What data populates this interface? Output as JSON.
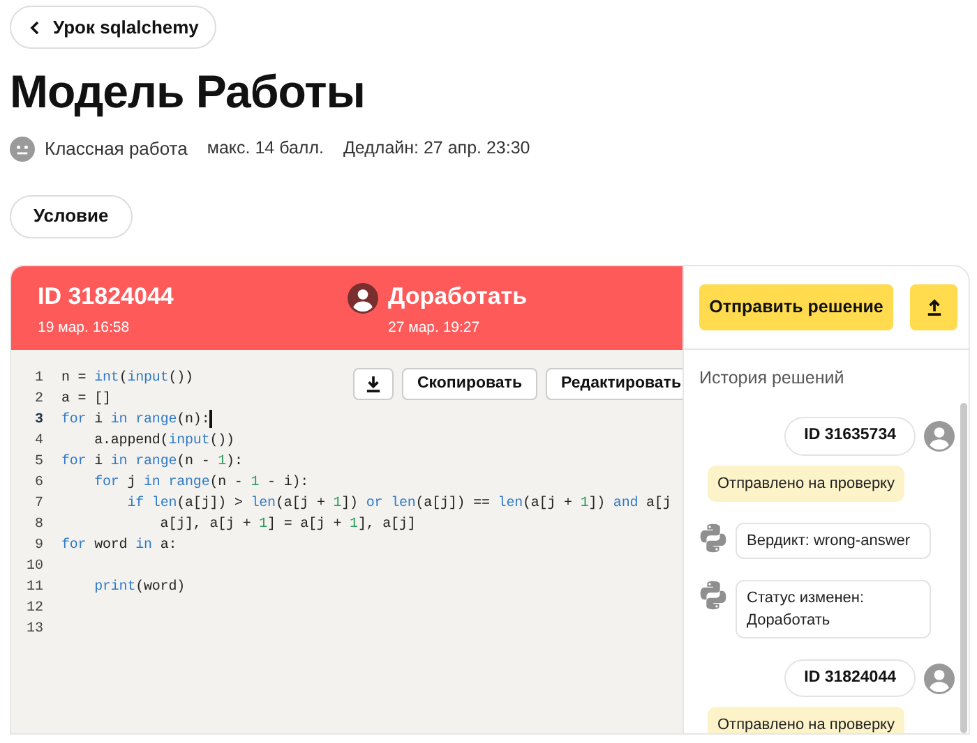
{
  "back_button": {
    "label": "Урок sqlalchemy"
  },
  "title": "Модель Работы",
  "meta": {
    "type": "Классная работа",
    "max_score": "макс. 14 балл.",
    "deadline": "Дедлайн: 27 апр. 23:30"
  },
  "condition_button": {
    "label": "Условие"
  },
  "submission": {
    "id": "ID 31824044",
    "created": "19 мар. 16:58",
    "status": "Доработать",
    "status_time": "27 мар. 19:27"
  },
  "code_toolbar": {
    "copy": "Скопировать",
    "edit": "Редактировать"
  },
  "code_lines": [
    {
      "number": "1",
      "current": false,
      "tokens": [
        {
          "text": "n = ",
          "kind": "plain"
        },
        {
          "text": "int",
          "kind": "keyword"
        },
        {
          "text": "(",
          "kind": "plain"
        },
        {
          "text": "input",
          "kind": "keyword"
        },
        {
          "text": "())",
          "kind": "plain"
        }
      ]
    },
    {
      "number": "2",
      "current": false,
      "tokens": [
        {
          "text": "a = []",
          "kind": "plain"
        }
      ]
    },
    {
      "number": "3",
      "current": true,
      "tokens": [
        {
          "text": "for",
          "kind": "keyword"
        },
        {
          "text": " i ",
          "kind": "plain"
        },
        {
          "text": "in",
          "kind": "keyword"
        },
        {
          "text": " range",
          "kind": "keyword"
        },
        {
          "text": "(n):",
          "kind": "plain"
        }
      ]
    },
    {
      "number": "4",
      "current": false,
      "tokens": [
        {
          "text": "    a.append(",
          "kind": "plain"
        },
        {
          "text": "input",
          "kind": "keyword"
        },
        {
          "text": "())",
          "kind": "plain"
        }
      ]
    },
    {
      "number": "5",
      "current": false,
      "tokens": [
        {
          "text": "for",
          "kind": "keyword"
        },
        {
          "text": " i ",
          "kind": "plain"
        },
        {
          "text": "in",
          "kind": "keyword"
        },
        {
          "text": " range",
          "kind": "keyword"
        },
        {
          "text": "(n - ",
          "kind": "plain"
        },
        {
          "text": "1",
          "kind": "number"
        },
        {
          "text": "):",
          "kind": "plain"
        }
      ]
    },
    {
      "number": "6",
      "current": false,
      "tokens": [
        {
          "text": "    for",
          "kind": "keyword"
        },
        {
          "text": " j ",
          "kind": "plain"
        },
        {
          "text": "in",
          "kind": "keyword"
        },
        {
          "text": " range",
          "kind": "keyword"
        },
        {
          "text": "(n - ",
          "kind": "plain"
        },
        {
          "text": "1",
          "kind": "number"
        },
        {
          "text": " - i):",
          "kind": "plain"
        }
      ]
    },
    {
      "number": "7",
      "current": false,
      "tokens": [
        {
          "text": "        if",
          "kind": "keyword"
        },
        {
          "text": " len",
          "kind": "keyword"
        },
        {
          "text": "(a[j]) > ",
          "kind": "plain"
        },
        {
          "text": "len",
          "kind": "keyword"
        },
        {
          "text": "(a[j + ",
          "kind": "plain"
        },
        {
          "text": "1",
          "kind": "number"
        },
        {
          "text": "]) ",
          "kind": "plain"
        },
        {
          "text": "or",
          "kind": "keyword"
        },
        {
          "text": " len",
          "kind": "keyword"
        },
        {
          "text": "(a[j]) == ",
          "kind": "plain"
        },
        {
          "text": "len",
          "kind": "keyword"
        },
        {
          "text": "(a[j + ",
          "kind": "plain"
        },
        {
          "text": "1",
          "kind": "number"
        },
        {
          "text": "]) ",
          "kind": "plain"
        },
        {
          "text": "and",
          "kind": "keyword"
        },
        {
          "text": " a[j",
          "kind": "plain"
        }
      ]
    },
    {
      "number": "8",
      "current": false,
      "tokens": [
        {
          "text": "            a[j], a[j + ",
          "kind": "plain"
        },
        {
          "text": "1",
          "kind": "number"
        },
        {
          "text": "] = a[j + ",
          "kind": "plain"
        },
        {
          "text": "1",
          "kind": "number"
        },
        {
          "text": "], a[j]",
          "kind": "plain"
        }
      ]
    },
    {
      "number": "9",
      "current": false,
      "tokens": [
        {
          "text": "for",
          "kind": "keyword"
        },
        {
          "text": " word ",
          "kind": "plain"
        },
        {
          "text": "in",
          "kind": "keyword"
        },
        {
          "text": " a:",
          "kind": "plain"
        }
      ]
    },
    {
      "number": "10",
      "current": false
    },
    {
      "number": "11",
      "current": false,
      "tokens": [
        {
          "text": "    print",
          "kind": "keyword"
        },
        {
          "text": "(word)",
          "kind": "plain"
        }
      ]
    },
    {
      "number": "12",
      "current": false
    },
    {
      "number": "13",
      "current": false
    }
  ],
  "send_button": {
    "label": "Отправить решение"
  },
  "history": {
    "title": "История решений",
    "items": [
      {
        "kind": "submission",
        "text": "ID 31635734"
      },
      {
        "kind": "status",
        "text": "Отправлено на проверку"
      },
      {
        "kind": "bot",
        "text": "Вердикт: wrong-answer"
      },
      {
        "kind": "bot",
        "text": "Статус изменен: Доработать"
      },
      {
        "kind": "submission",
        "text": "ID 31824044"
      },
      {
        "kind": "status",
        "text": "Отправлено на проверку"
      }
    ]
  }
}
